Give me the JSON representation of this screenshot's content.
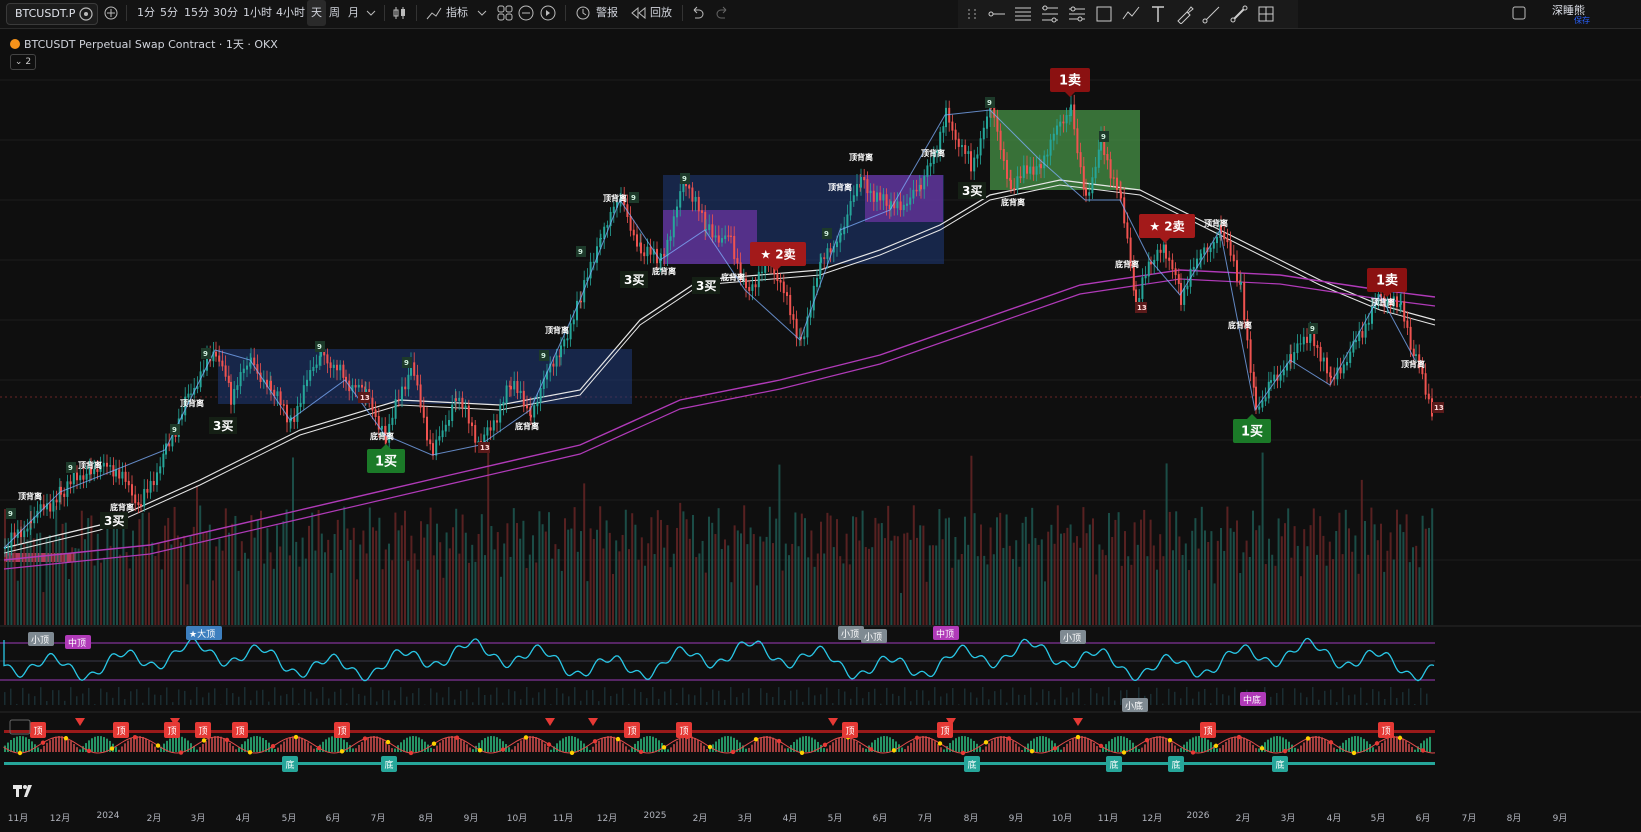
{
  "toolbar": {
    "symbol": "BTCUSDT.P",
    "timeframes": [
      "1分",
      "5分",
      "15分",
      "30分",
      "1小时",
      "4小时",
      "天",
      "周",
      "月"
    ],
    "active_timeframe": "天",
    "indicators_label": "指标",
    "alert_label": "警报",
    "replay_label": "回放",
    "right_label": "深睡熊",
    "right_sublabel": "保存"
  },
  "legend": {
    "title": "BTCUSDT Perpetual Swap Contract · 1天 · OKX",
    "collapsed_count": "2"
  },
  "colors": {
    "background": "#0f0f0f",
    "up": "#26a69a",
    "down": "#ef5350",
    "ma_white": "#e6e6e6",
    "ma_purple": "#b03ab8",
    "oscillator": "#29c7e6",
    "buy_label": "#1b7a28",
    "sell_label": "#8b1111",
    "box_blue": "#1f3a7a",
    "box_purple": "#7d37b4",
    "box_green": "#4a9b4a"
  },
  "annotations": {
    "buy3": "3买",
    "buy1": "1买",
    "sell1": "1卖",
    "sell2": "★ 2卖",
    "top_div": "顶背离",
    "bottom_div": "底背离",
    "nine": "9",
    "thirteen": "13"
  },
  "oscillator_tags": {
    "small_top": "小顶",
    "mid_top": "中顶",
    "big_top": "★大顶",
    "small_bottom": "小底",
    "mid_bottom": "中底"
  },
  "bottom_tags": {
    "top": "顶",
    "bottom": "底"
  },
  "xaxis": {
    "labels": [
      "11月",
      "12月",
      "2024",
      "2月",
      "3月",
      "4月",
      "5月",
      "6月",
      "7月",
      "8月",
      "9月",
      "10月",
      "11月",
      "12月",
      "2025",
      "2月",
      "3月",
      "4月",
      "5月",
      "6月",
      "7月",
      "8月",
      "9月",
      "10月",
      "11月",
      "12月",
      "2026",
      "2月",
      "3月",
      "4月",
      "5月",
      "6月",
      "7月",
      "8月",
      "9月"
    ]
  }
}
